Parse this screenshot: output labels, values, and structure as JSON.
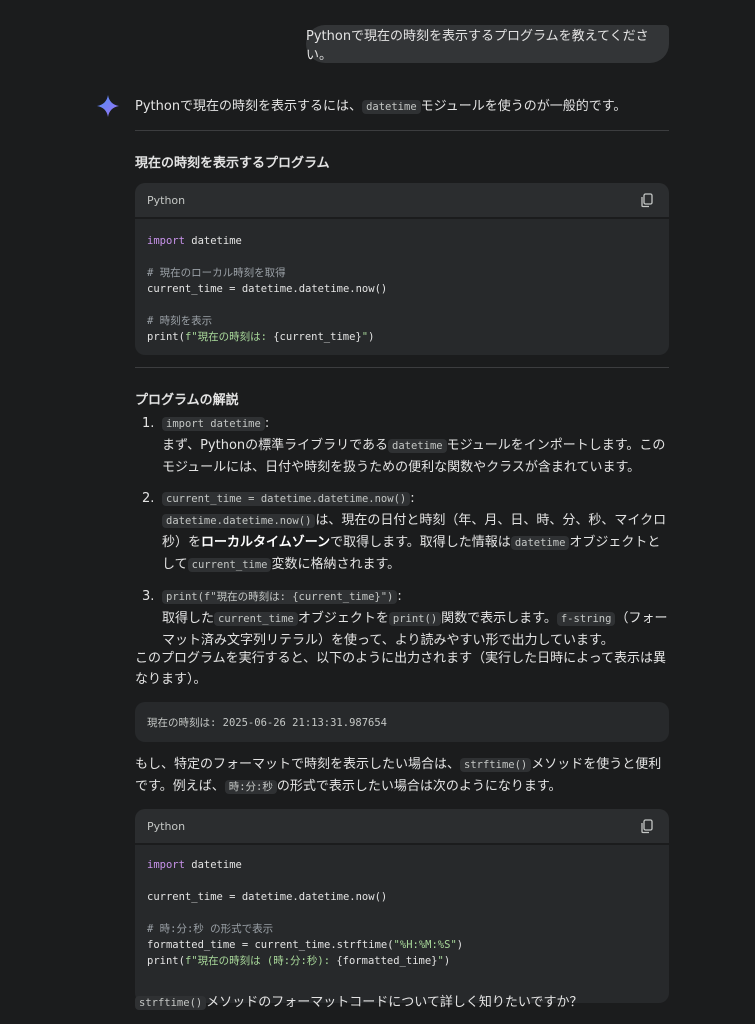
{
  "user_message": "Pythonで現在の時刻を表示するプログラムを教えてください。",
  "intro": {
    "before": "Pythonで現在の時刻を表示するには、",
    "code": "datetime",
    "after": "モジュールを使うのが一般的です。"
  },
  "section1_title": "現在の時刻を表示するプログラム",
  "code1": {
    "language": "Python",
    "copy_icon": "copy-icon",
    "line1_kw": "import",
    "line1_rest": " datetime",
    "comment1": "# 現在のローカル時刻を取得",
    "line2": "current_time = datetime.datetime.now()",
    "comment2": "# 時刻を表示",
    "line3_a": "print(",
    "line3_str1": "f\"現在の時刻は: ",
    "line3_var": "{current_time}",
    "line3_str2": "\"",
    "line3_b": ")"
  },
  "section2_title": "プログラムの解説",
  "explain": {
    "item1": {
      "num": "1.",
      "code": "import datetime",
      "colon": ":",
      "t1": "まず、Pythonの標準ライブラリである",
      "code2": "datetime",
      "t2": "モジュールをインポートします。このモジュールには、日付や時刻を扱うための便利な関数やクラスが含まれています。"
    },
    "item2": {
      "num": "2.",
      "code": "current_time = datetime.datetime.now()",
      "colon": ":",
      "code2": "datetime.datetime.now()",
      "t1": "は、現在の日付と時刻（年、月、日、時、分、秒、マイクロ秒）を",
      "bold": "ローカルタイムゾーン",
      "t2": "で取得します。取得した情報は",
      "code3": "datetime",
      "t3": "オブジェクトとして",
      "code4": "current_time",
      "t4": "変数に格納されます。"
    },
    "item3": {
      "num": "3.",
      "code": "print(f\"現在の時刻は: {current_time}\")",
      "colon": ":",
      "t1": "取得した",
      "code2": "current_time",
      "t2": "オブジェクトを",
      "code3": "print()",
      "t3": "関数で表示します。",
      "code4": "f-string",
      "t4": "（フォーマット済み文字列リテラル）を使って、より読みやすい形で出力しています。"
    }
  },
  "run_text": "このプログラムを実行すると、以下のように出力されます（実行した日時によって表示は異なります）。",
  "output_sample": "現在の時刻は: 2025-06-26 21:13:31.987654",
  "strftime_text": {
    "t1": "もし、特定のフォーマットで時刻を表示したい場合は、",
    "code1": "strftime()",
    "t2": "メソッドを使うと便利です。例えば、",
    "code2": "時:分:秒",
    "t3": "の形式で表示したい場合は次のようになります。"
  },
  "code2": {
    "language": "Python",
    "line1_kw": "import",
    "line1_rest": " datetime",
    "line2": "current_time = datetime.datetime.now()",
    "comment1": "# 時:分:秒 の形式で表示",
    "line3_a": "formatted_time = current_time.strftime(",
    "line3_str": "\"%H:%M:%S\"",
    "line3_b": ")",
    "line4_a": "print(",
    "line4_str1": "f\"現在の時刻は (時:分:秒): ",
    "line4_var": "{formatted_time}",
    "line4_str2": "\"",
    "line4_b": ")"
  },
  "closing": {
    "code": "strftime()",
    "text": "メソッドのフォーマットコードについて詳しく知りたいですか？"
  }
}
